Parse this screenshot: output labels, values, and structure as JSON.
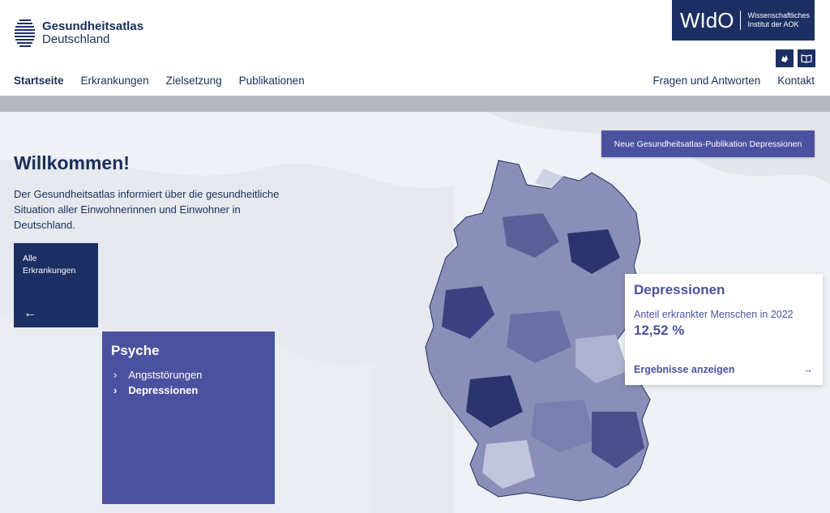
{
  "header": {
    "logo_title": "Gesundheitsatlas",
    "logo_subtitle": "Deutschland",
    "wido_mark": "WIdO",
    "wido_sub_line1": "Wissenschaftliches",
    "wido_sub_line2": "Institut der AOK"
  },
  "nav": {
    "items": [
      "Startseite",
      "Erkrankungen",
      "Zielsetzung",
      "Publikationen"
    ],
    "right_items": [
      "Fragen und Antworten",
      "Kontakt"
    ],
    "active": "Startseite"
  },
  "icons": {
    "sign_language": "sign-language-icon",
    "easy_read": "easy-read-book-icon"
  },
  "main": {
    "welcome_title": "Willkommen!",
    "welcome_text": "Der Gesundheitsatlas informiert über die gesundheitliche Situation aller Einwohnerinnen und Einwohner in Deutschland.",
    "all_label_line1": "Alle",
    "all_label_line2": "Erkrankungen",
    "back_arrow": "←",
    "publication_button": "Neue Gesundheitsatlas-Publikation Depressionen",
    "category": {
      "title": "Psyche",
      "items": [
        "Angststörungen",
        "Depressionen"
      ],
      "active_item": "Depressionen"
    },
    "card": {
      "title": "Depressionen",
      "label": "Anteil erkrankter Menschen in 2022",
      "value": "12,52 %",
      "link": "Ergebnisse anzeigen",
      "link_arrow": "→"
    }
  },
  "colors": {
    "navy": "#1c2f63",
    "violet": "#4a52a0",
    "graybar": "#b5b8bd"
  }
}
